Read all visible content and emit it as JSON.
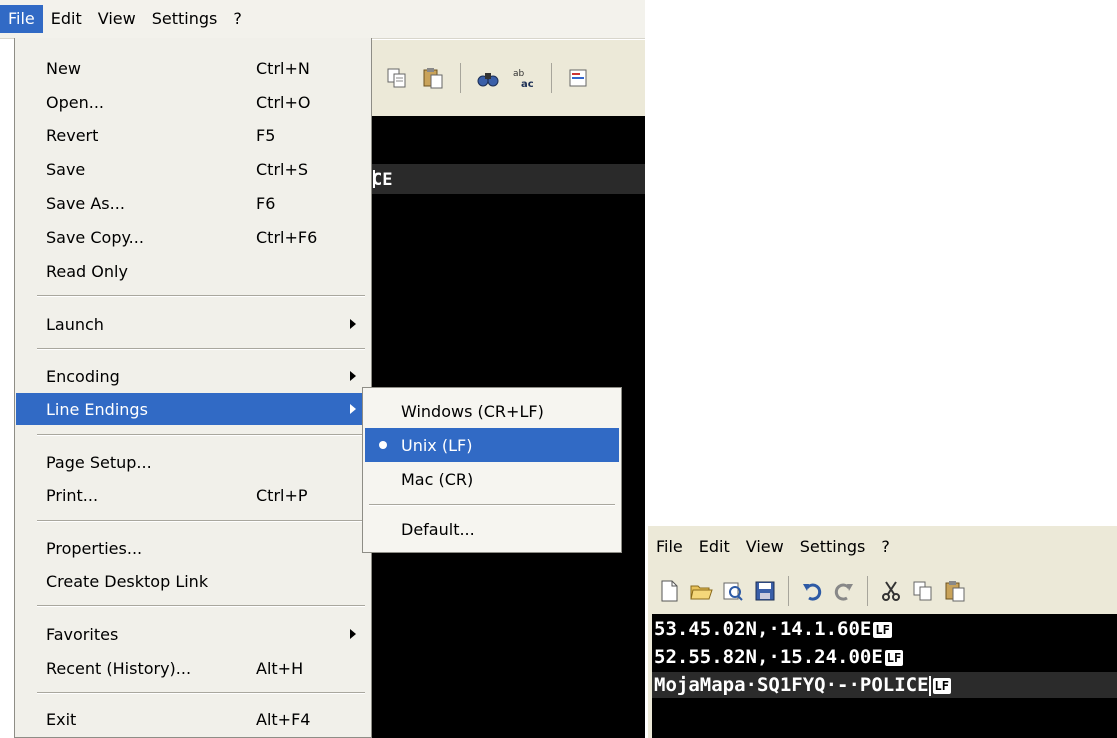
{
  "left_window": {
    "menubar": [
      "File",
      "Edit",
      "View",
      "Settings",
      "?"
    ],
    "editor_fragment": "CE",
    "file_menu": {
      "items": [
        {
          "label": "New",
          "shortcut": "Ctrl+N"
        },
        {
          "label": "Open...",
          "shortcut": "Ctrl+O"
        },
        {
          "label": "Revert",
          "shortcut": "F5"
        },
        {
          "label": "Save",
          "shortcut": "Ctrl+S"
        },
        {
          "label": "Save As...",
          "shortcut": "F6"
        },
        {
          "label": "Save Copy...",
          "shortcut": "Ctrl+F6"
        },
        {
          "label": "Read Only",
          "shortcut": ""
        },
        {
          "label": "Launch",
          "shortcut": ""
        },
        {
          "label": "Encoding",
          "shortcut": ""
        },
        {
          "label": "Line Endings",
          "shortcut": ""
        },
        {
          "label": "Page Setup...",
          "shortcut": ""
        },
        {
          "label": "Print...",
          "shortcut": "Ctrl+P"
        },
        {
          "label": "Properties...",
          "shortcut": ""
        },
        {
          "label": "Create Desktop Link",
          "shortcut": ""
        },
        {
          "label": "Favorites",
          "shortcut": ""
        },
        {
          "label": "Recent (History)...",
          "shortcut": "Alt+H"
        },
        {
          "label": "Exit",
          "shortcut": "Alt+F4"
        }
      ]
    },
    "line_endings_submenu": {
      "items": [
        "Windows (CR+LF)",
        "Unix (LF)",
        "Mac (CR)",
        "Default..."
      ],
      "selected": "Unix (LF)"
    }
  },
  "right_window": {
    "menubar": [
      "File",
      "Edit",
      "View",
      "Settings",
      "?"
    ],
    "lines": [
      {
        "text": "53.45.02N,·14.1.60E",
        "ending": "LF"
      },
      {
        "text": "52.55.82N,·15.24.00E",
        "ending": "LF"
      },
      {
        "text": "MojaMapa·SQ1FYQ·-·POLICE",
        "ending": "LF"
      }
    ]
  },
  "colors": {
    "highlight": "#316ac5",
    "menu_bg": "#f1f0ea",
    "editor_bg": "#000000"
  }
}
